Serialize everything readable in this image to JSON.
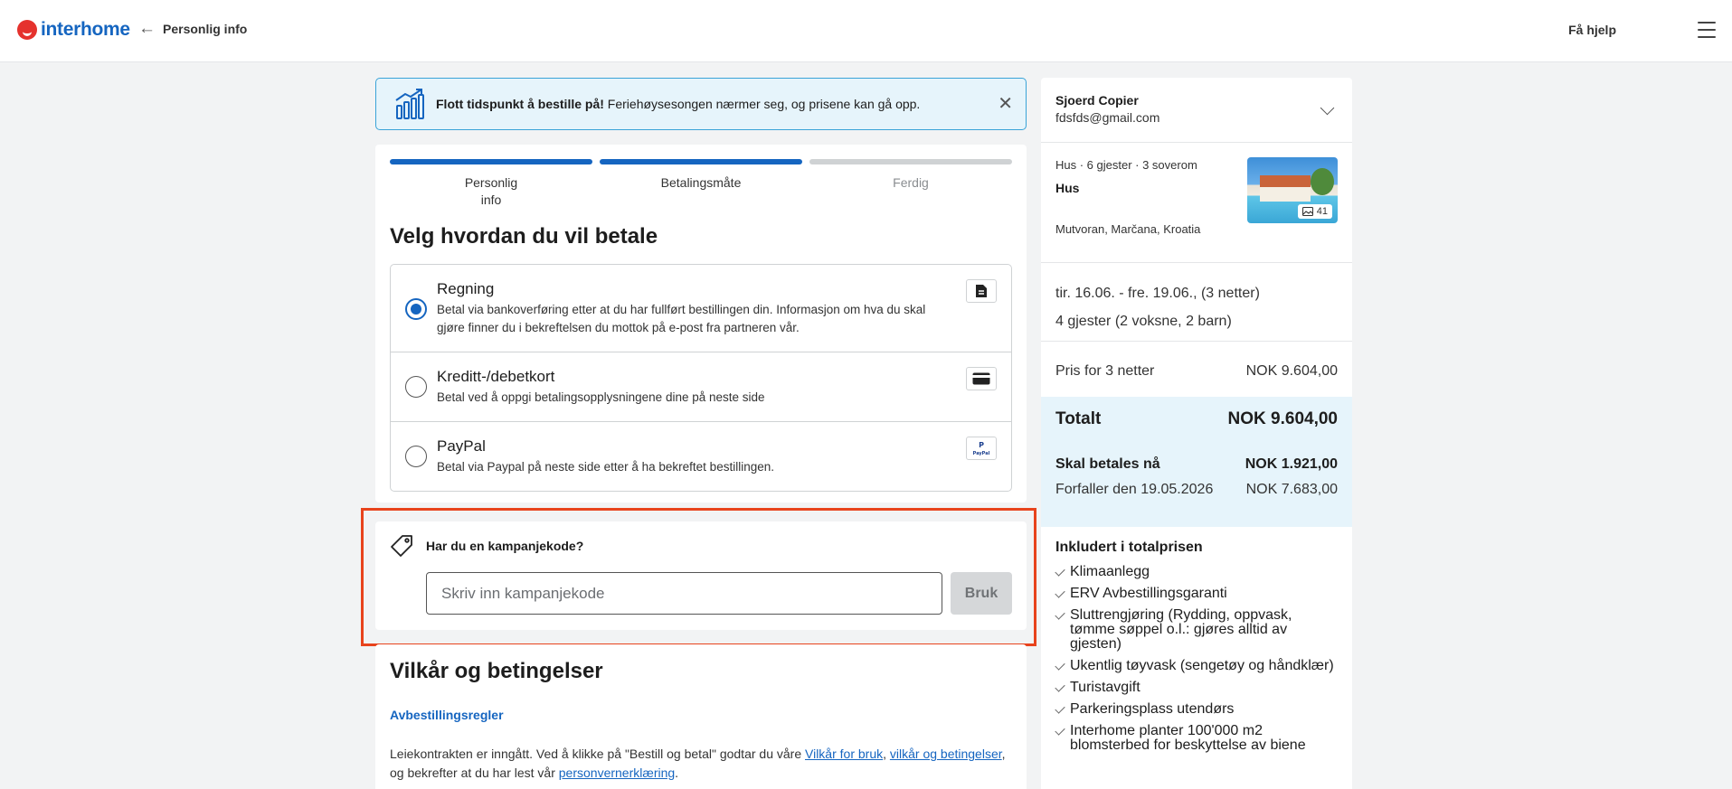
{
  "header": {
    "logo_text": "interhome",
    "back_label": "Personlig info",
    "help_label": "Få hjelp"
  },
  "banner": {
    "bold_text": "Flott tidspunkt å bestille på!",
    "text": " Feriehøysesongen nærmer seg, og prisene kan gå opp."
  },
  "steps": [
    {
      "label": "Personlig\ninfo",
      "state": "done"
    },
    {
      "label": "Betalingsmåte",
      "state": "done"
    },
    {
      "label": "Ferdig",
      "state": "todo"
    }
  ],
  "payment": {
    "title": "Velg hvordan du vil betale",
    "options": [
      {
        "title": "Regning",
        "desc": "Betal via bankoverføring etter at du har fullført bestillingen din. Informasjon om hva du skal gjøre finner du i bekreftelsen du mottok på e-post fra partneren vår.",
        "selected": true,
        "badge": "document-icon"
      },
      {
        "title": "Kreditt-/debetkort",
        "desc": "Betal ved å oppgi betalingsopplysningene dine på neste side",
        "selected": false,
        "badge": "card-icon"
      },
      {
        "title": "PayPal",
        "desc": "Betal via Paypal på neste side etter å ha bekreftet bestillingen.",
        "selected": false,
        "badge": "paypal-icon"
      }
    ]
  },
  "promo": {
    "label": "Har du en kampanjekode?",
    "placeholder": "Skriv inn kampanjekode",
    "button": "Bruk"
  },
  "terms": {
    "title": "Vilkår og betingelser",
    "link": "Avbestillingsregler",
    "text_1": "Leiekontrakten er inngått. Ved å klikke på \"Bestill og betal\" godtar du våre ",
    "link_1": "Vilkår for bruk",
    "sep_1": ", ",
    "link_2": "vilkår og betingelser",
    "text_2": ",",
    "text_3": "og bekrefter at du har lest vår ",
    "link_3": "personvernerklæring",
    "text_4": "."
  },
  "sidebar": {
    "name": "Sjoerd Copier",
    "email": "fdsfds@gmail.com",
    "meta": "Hus · 6 gjester · 3 soverom",
    "type": "Hus",
    "location": "Mutvoran, Marčana, Kroatia",
    "photo_count": "41",
    "dates": "tir. 16.06. - fre. 19.06., (3 netter)",
    "guests": "4 gjester (2 voksne, 2 barn)",
    "price_label": "Pris for 3 netter",
    "price_value": "NOK 9.604,00",
    "total_label": "Totalt",
    "total_value": "NOK 9.604,00",
    "pay_now_label": "Skal betales nå",
    "pay_now_value": "NOK 1.921,00",
    "due_label": "Forfaller den 19.05.2026",
    "due_value": "NOK 7.683,00",
    "included_title": "Inkludert i totalprisen",
    "included": [
      "Klimaanlegg",
      "ERV Avbestillingsgaranti",
      "Sluttrengjøring (Rydding, oppvask, tømme søppel o.l.: gjøres alltid av gjesten)",
      "Ukentlig tøyvask (sengetøy og håndklær)",
      "Turistavgift",
      "Parkeringsplass utendørs",
      "Interhome planter 100'000 m2 blomsterbed for beskyttelse av biene"
    ]
  },
  "colors": {
    "accent": "#1565c0",
    "highlight": "#e8431c",
    "banner_bg": "#e6f4fb"
  }
}
